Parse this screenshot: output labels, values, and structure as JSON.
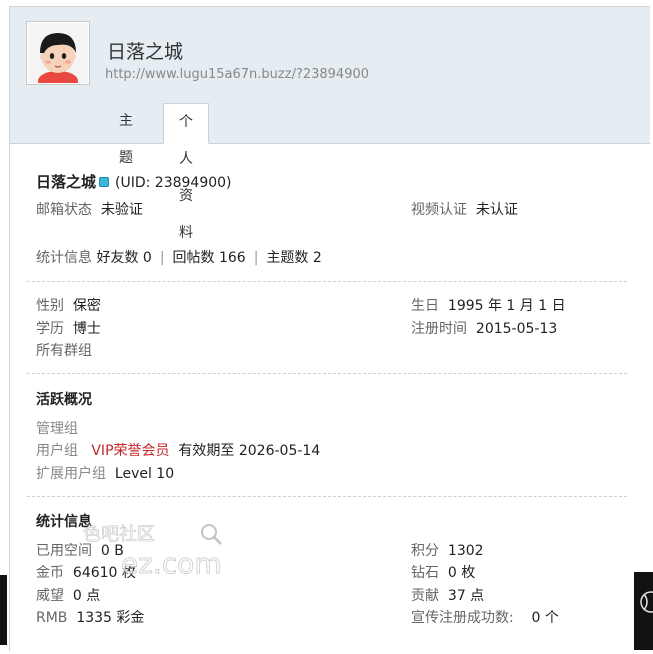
{
  "header": {
    "username": "日落之城",
    "url": "http://www.lugu15a67n.buzz/?23894900",
    "tabs": [
      {
        "label": "主题",
        "active": false
      },
      {
        "label": "个人资料",
        "active": true
      }
    ]
  },
  "profile": {
    "name": "日落之城",
    "uid": "(UID: 23894900)",
    "email_status_label": "邮箱状态",
    "email_status_value": "未验证",
    "video_auth_label": "视频认证",
    "video_auth_value": "未认证",
    "stats_label": "统计信息",
    "friends": "好友数 0",
    "posts": "回帖数 166",
    "threads": "主题数 2",
    "sep": "|"
  },
  "details": {
    "gender_label": "性别",
    "gender_value": "保密",
    "birthday_label": "生日",
    "birthday_value": "1995 年 1 月 1 日",
    "education_label": "学历",
    "education_value": "博士",
    "register_label": "注册时间",
    "register_value": "2015-05-13",
    "groups_label": "所有群组"
  },
  "activity": {
    "title": "活跃概况",
    "admin_group_label": "管理组",
    "user_group_label": "用户组",
    "user_group_value": "VIP荣誉会员",
    "valid_until": "有效期至 2026-05-14",
    "ext_group_label": "扩展用户组",
    "ext_group_value": "Level 10"
  },
  "statistics": {
    "title": "统计信息",
    "space_label": "已用空间",
    "space_value": "0 B",
    "points_label": "积分",
    "points_value": "1302",
    "coins_label": "金币",
    "coins_value": "64610 枚",
    "diamond_label": "钻石",
    "diamond_value": "0 枚",
    "prestige_label": "威望",
    "prestige_value": "0 点",
    "contrib_label": "贡献",
    "contrib_value": "37 点",
    "rmb_label": "RMB",
    "rmb_value": "1335 彩金",
    "promo_label": "宣传注册成功数:",
    "promo_value": "0 个"
  },
  "watermark": {
    "line1": "色吧社区",
    "line2": "ez.com"
  },
  "colors": {
    "header_bg": "#e5edf2",
    "accent_red": "#c3262b",
    "online_dot": "#3ab5d6"
  }
}
